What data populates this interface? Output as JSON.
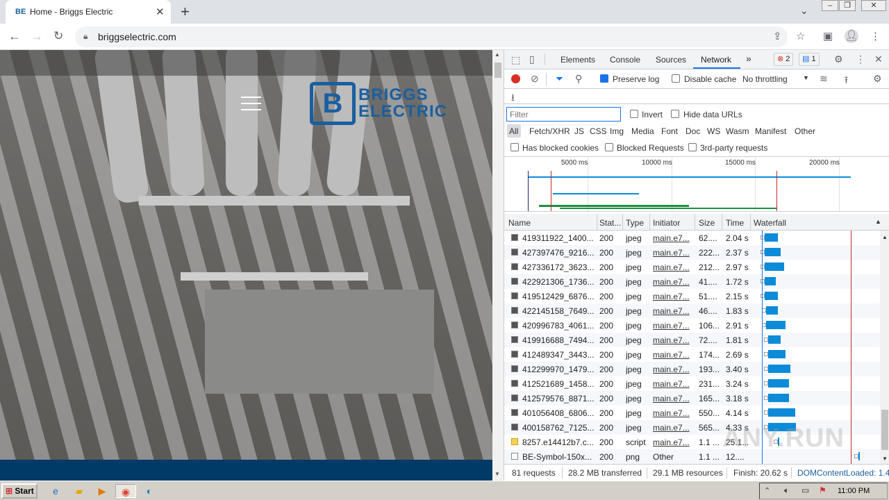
{
  "browser": {
    "tab_title": "Home - Briggs Electric",
    "tab_favicon": "BE",
    "url": "briggselectric.com"
  },
  "site": {
    "logo_mark": "B",
    "logo_line1": "BRIGGS",
    "logo_line2": "ELECTRIC",
    "brand_color": "#1a5fa0",
    "footer_color": "#003a66"
  },
  "devtools": {
    "tabs": [
      "Elements",
      "Console",
      "Sources",
      "Network"
    ],
    "more_tabs": "»",
    "error_count": "2",
    "message_count": "1",
    "preserve_log": "Preserve log",
    "disable_cache": "Disable cache",
    "throttling": "No throttling",
    "filter_placeholder": "Filter",
    "invert": "Invert",
    "hide_data_urls": "Hide data URLs",
    "type_filters": [
      "All",
      "Fetch/XHR",
      "JS",
      "CSS",
      "Img",
      "Media",
      "Font",
      "Doc",
      "WS",
      "Wasm",
      "Manifest",
      "Other"
    ],
    "has_blocked_cookies": "Has blocked cookies",
    "blocked_requests": "Blocked Requests",
    "third_party": "3rd-party requests",
    "overview_ticks": [
      "5000 ms",
      "10000 ms",
      "15000 ms",
      "20000 ms"
    ],
    "columns": {
      "name": "Name",
      "status": "Stat...",
      "type": "Type",
      "initiator": "Initiator",
      "size": "Size",
      "time": "Time",
      "waterfall": "Waterfall"
    },
    "rows": [
      {
        "name": "419311922_1400...",
        "status": "200",
        "type": "jpeg",
        "initiator": "main.e7...",
        "size": "62....",
        "time": "2.04 s",
        "wf_start": 0.09,
        "wf_len": 0.11
      },
      {
        "name": "427397476_9216...",
        "status": "200",
        "type": "jpeg",
        "initiator": "main.e7...",
        "size": "222...",
        "time": "2.37 s",
        "wf_start": 0.09,
        "wf_len": 0.13
      },
      {
        "name": "427336172_3623...",
        "status": "200",
        "type": "jpeg",
        "initiator": "main.e7...",
        "size": "212...",
        "time": "2.97 s",
        "wf_start": 0.09,
        "wf_len": 0.16
      },
      {
        "name": "422921306_1736...",
        "status": "200",
        "type": "jpeg",
        "initiator": "main.e7...",
        "size": "41....",
        "time": "1.72 s",
        "wf_start": 0.09,
        "wf_len": 0.09
      },
      {
        "name": "419512429_6876...",
        "status": "200",
        "type": "jpeg",
        "initiator": "main.e7...",
        "size": "51....",
        "time": "2.15 s",
        "wf_start": 0.09,
        "wf_len": 0.11
      },
      {
        "name": "422145158_7649...",
        "status": "200",
        "type": "jpeg",
        "initiator": "main.e7...",
        "size": "46....",
        "time": "1.83 s",
        "wf_start": 0.1,
        "wf_len": 0.1
      },
      {
        "name": "420996783_4061...",
        "status": "200",
        "type": "jpeg",
        "initiator": "main.e7...",
        "size": "106...",
        "time": "2.91 s",
        "wf_start": 0.1,
        "wf_len": 0.16
      },
      {
        "name": "419916688_7494...",
        "status": "200",
        "type": "jpeg",
        "initiator": "main.e7...",
        "size": "72....",
        "time": "1.81 s",
        "wf_start": 0.12,
        "wf_len": 0.1
      },
      {
        "name": "412489347_3443...",
        "status": "200",
        "type": "jpeg",
        "initiator": "main.e7...",
        "size": "174...",
        "time": "2.69 s",
        "wf_start": 0.12,
        "wf_len": 0.14
      },
      {
        "name": "412299970_1479...",
        "status": "200",
        "type": "jpeg",
        "initiator": "main.e7...",
        "size": "193...",
        "time": "3.40 s",
        "wf_start": 0.12,
        "wf_len": 0.18
      },
      {
        "name": "412521689_1458...",
        "status": "200",
        "type": "jpeg",
        "initiator": "main.e7...",
        "size": "231...",
        "time": "3.24 s",
        "wf_start": 0.12,
        "wf_len": 0.17
      },
      {
        "name": "412579576_8871...",
        "status": "200",
        "type": "jpeg",
        "initiator": "main.e7...",
        "size": "165...",
        "time": "3.18 s",
        "wf_start": 0.12,
        "wf_len": 0.17
      },
      {
        "name": "401056408_6806...",
        "status": "200",
        "type": "jpeg",
        "initiator": "main.e7...",
        "size": "550...",
        "time": "4.14 s",
        "wf_start": 0.12,
        "wf_len": 0.22
      },
      {
        "name": "400158762_7125...",
        "status": "200",
        "type": "jpeg",
        "initiator": "main.e7...",
        "size": "565...",
        "time": "4.33 s",
        "wf_start": 0.12,
        "wf_len": 0.23
      },
      {
        "name": "8257.e14412b7.c...",
        "status": "200",
        "type": "script",
        "initiator": "main.e7...",
        "size": "1.1 ...",
        "time": "25.1...",
        "wf_start": 0.2,
        "wf_len": 0.01
      },
      {
        "name": "BE-Symbol-150x...",
        "status": "200",
        "type": "png",
        "initiator": "Other",
        "size": "1.1 ...",
        "time": "12....",
        "wf_start": 0.86,
        "wf_len": 0.01
      }
    ],
    "status": {
      "requests": "81 requests",
      "transferred": "28.2 MB transferred",
      "resources": "29.1 MB resources",
      "finish": "Finish: 20.62 s",
      "dcl": "DOMContentLoaded: 1.4"
    }
  },
  "taskbar": {
    "start": "Start",
    "clock": "11:00 PM"
  },
  "watermark": "ANY.RUN"
}
